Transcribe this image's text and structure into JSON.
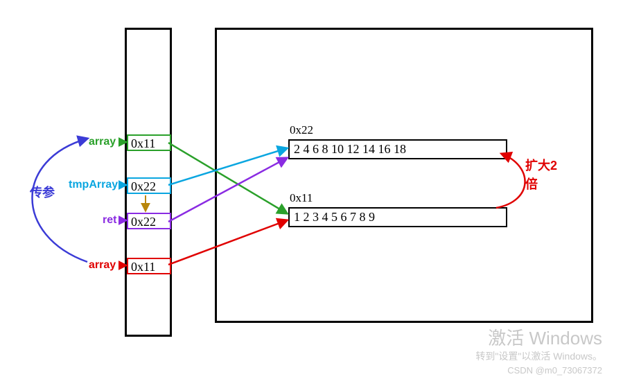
{
  "stack": {
    "array_top": {
      "label": "array",
      "value": "0x11",
      "color": "#2aa02a"
    },
    "tmp": {
      "label": "tmpArray",
      "value": "0x22",
      "color": "#0aa6e0"
    },
    "ret": {
      "label": "ret",
      "value": "0x22",
      "color": "#8a2be2"
    },
    "array_bot": {
      "label": "array",
      "value": "0x11",
      "color": "#e00000"
    }
  },
  "heap": {
    "addr22": "0x22",
    "addr11": "0x11",
    "row22": "2 4 6 8 10  12  14  16  18",
    "row11": "1 2 3 4 5 6 7 8 9"
  },
  "annot": {
    "param": "传参",
    "enlarge1": "扩大2",
    "enlarge2": "倍"
  },
  "watermark": {
    "big": "激活 Windows",
    "small": "转到\"设置\"以激活 Windows。",
    "credit": "CSDN @m0_73067372"
  }
}
